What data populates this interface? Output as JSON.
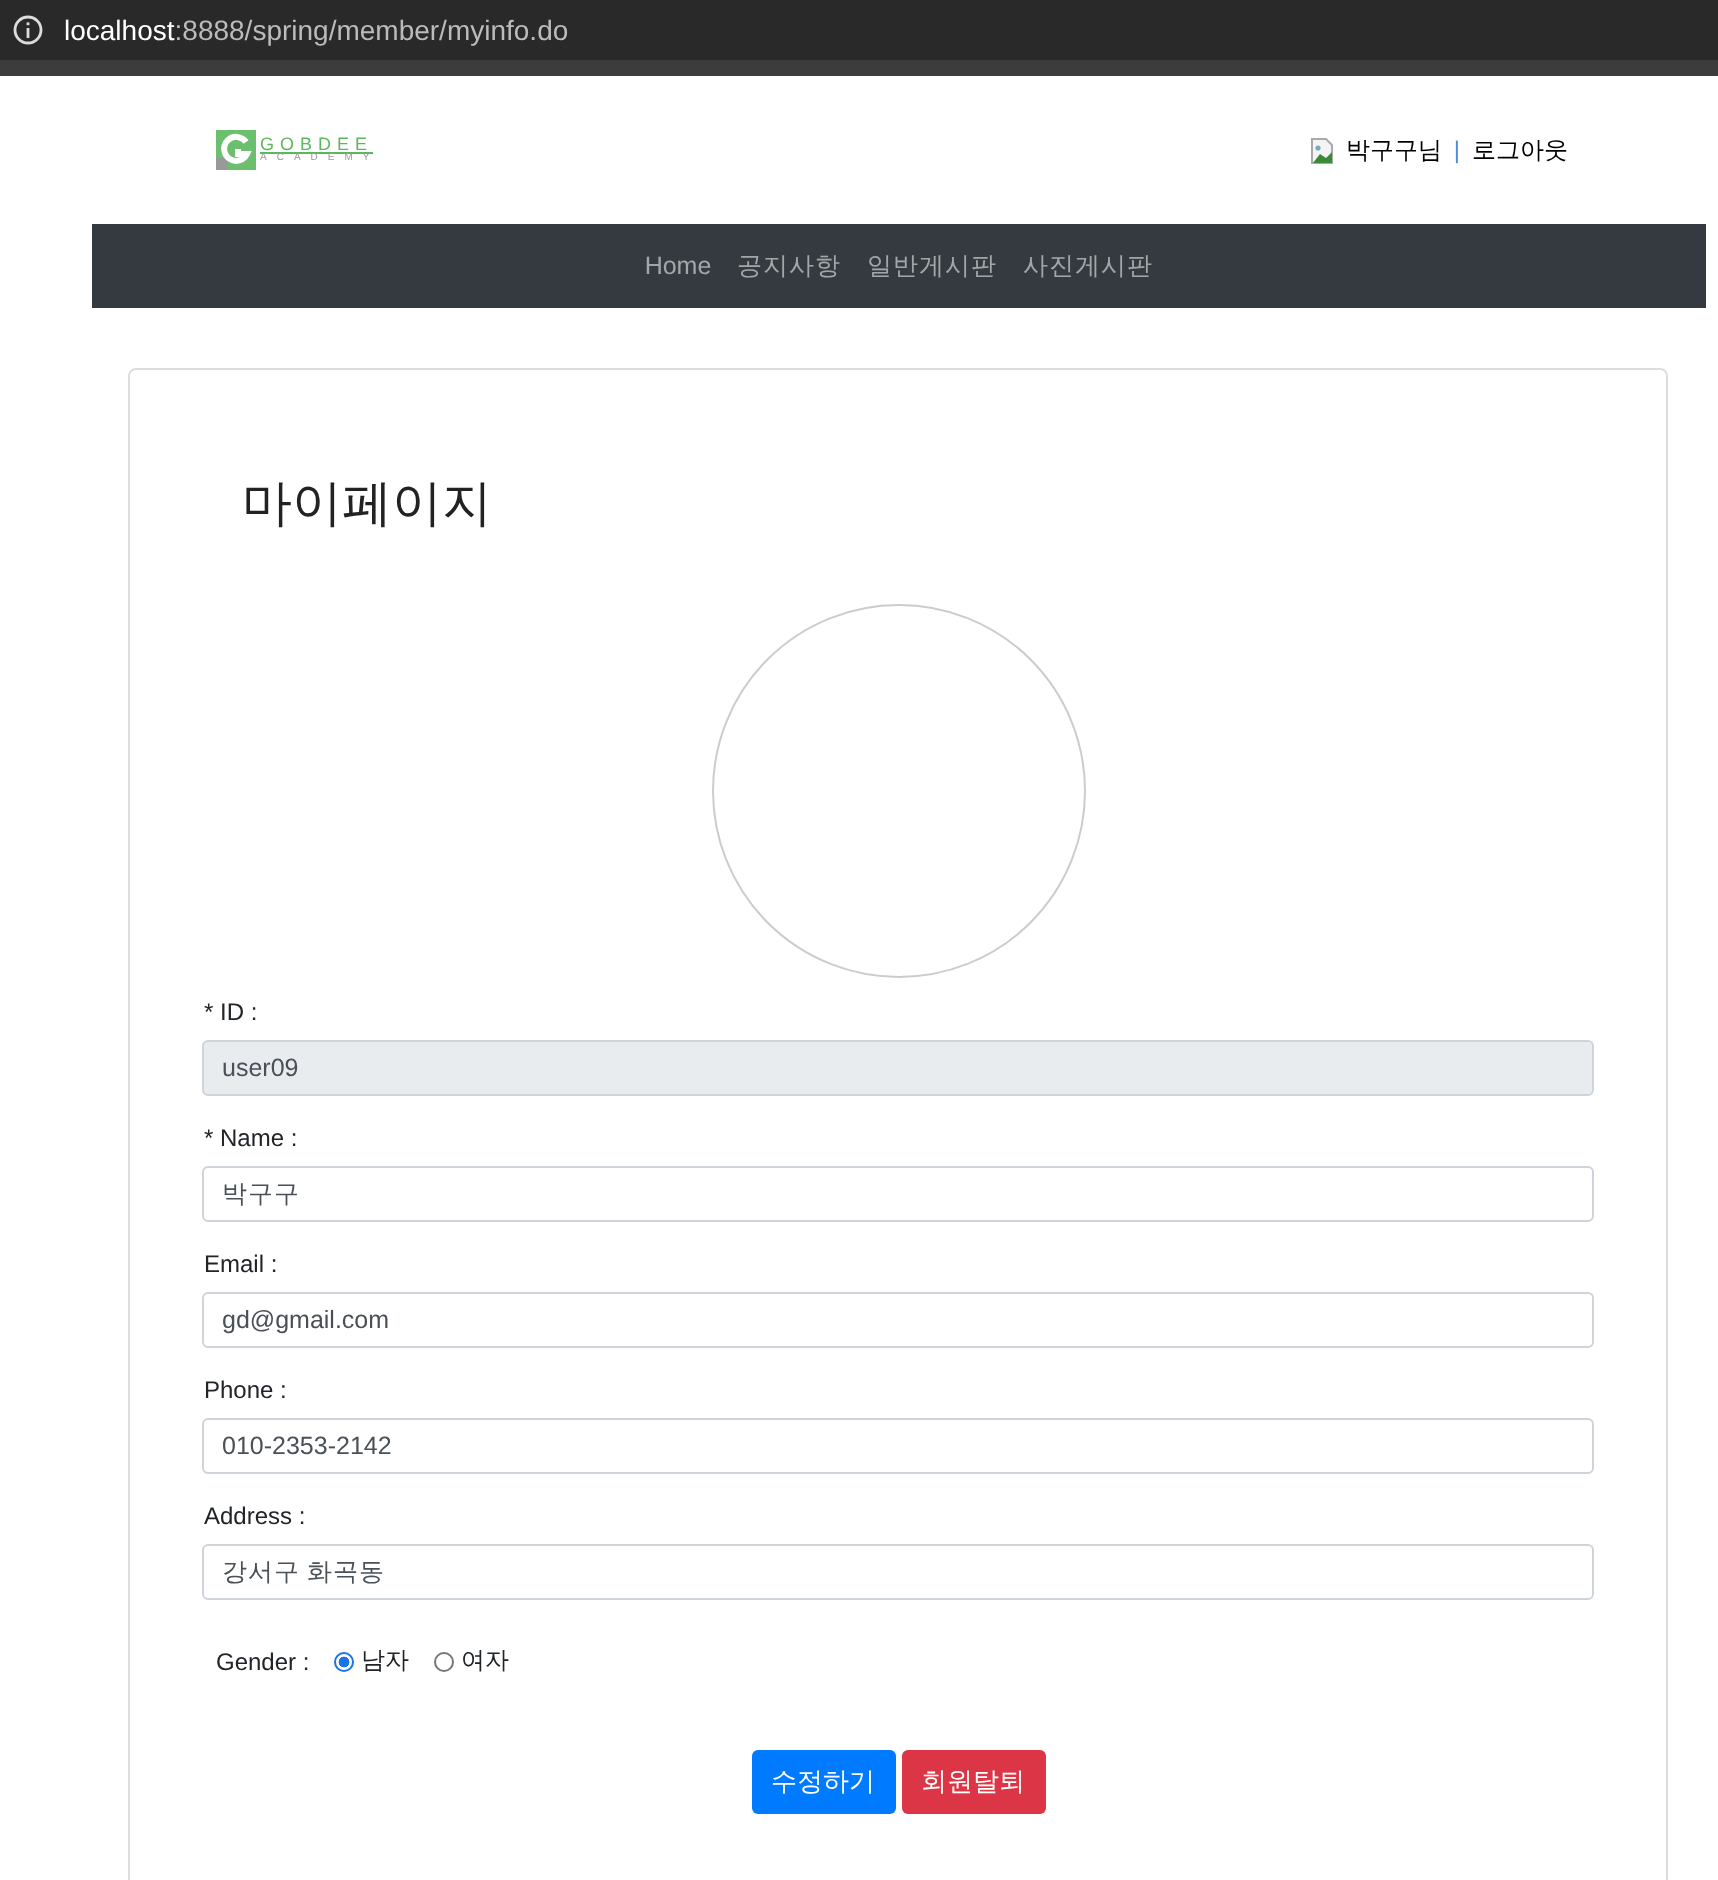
{
  "browser": {
    "url_host": "localhost",
    "url_rest": ":8888/spring/member/myinfo.do"
  },
  "logo": {
    "name": "GOBDEE",
    "tagline": "ACADEMY"
  },
  "user_menu": {
    "user": "박구구님",
    "separator": "|",
    "logout": "로그아웃"
  },
  "nav": [
    {
      "label": "Home"
    },
    {
      "label": "공지사항"
    },
    {
      "label": "일반게시판"
    },
    {
      "label": "사진게시판"
    }
  ],
  "page_title": "마이페이지",
  "fields": [
    {
      "label": "* ID :",
      "value": "user09",
      "readonly": true
    },
    {
      "label": "* Name :",
      "value": "박구구",
      "readonly": false
    },
    {
      "label": "Email :",
      "value": "gd@gmail.com",
      "readonly": false
    },
    {
      "label": "Phone :",
      "value": "010-2353-2142",
      "readonly": false
    },
    {
      "label": "Address :",
      "value": "강서구 화곡동",
      "readonly": false
    }
  ],
  "gender": {
    "label": "Gender :",
    "options": [
      {
        "label": "남자",
        "selected": true
      },
      {
        "label": "여자",
        "selected": false
      }
    ]
  },
  "buttons": [
    {
      "label": "수정하기",
      "kind": "primary"
    },
    {
      "label": "회원탈퇴",
      "kind": "danger"
    }
  ]
}
